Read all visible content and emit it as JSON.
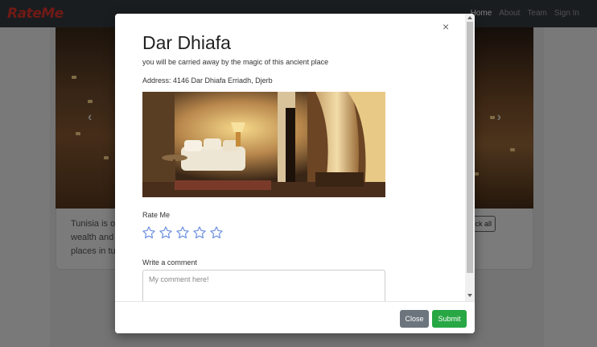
{
  "navbar": {
    "brand": "RateMe",
    "links": [
      "Home",
      "About",
      "Team",
      "Sign In"
    ]
  },
  "background": {
    "card_text": "Tunisia is on wealth and c places in tu",
    "card_button": "ck all"
  },
  "modal": {
    "close_icon": "×",
    "title": "Dar Dhiafa",
    "subtitle": "you will be carried away by the magic of this ancient place",
    "address": "Address: 4146 Dar Dhiafa Erriadh, Djerb",
    "rating": {
      "label": "Rate Me",
      "star_count": 5,
      "selected": 0,
      "star_color": "#6b8fe0"
    },
    "comment": {
      "label": "Write a comment",
      "placeholder": "My comment here!",
      "value": ""
    },
    "buttons": {
      "close": "Close",
      "submit": "Submit"
    }
  },
  "colors": {
    "navbar": "#343a40",
    "close_button": "#6c757d",
    "submit_button": "#28a745",
    "brand": "#e0342c"
  }
}
